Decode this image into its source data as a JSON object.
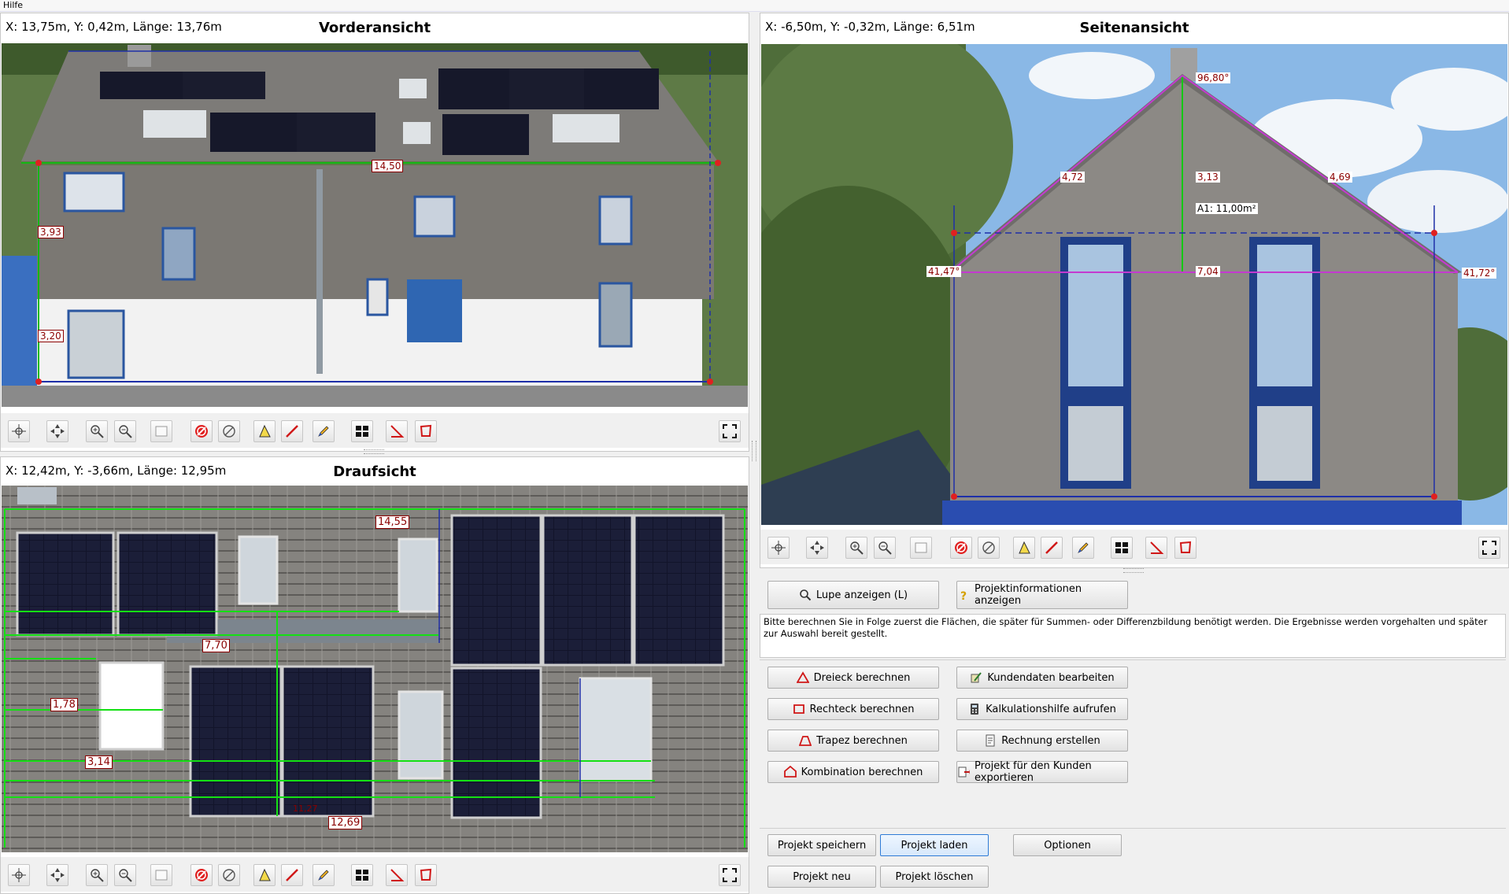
{
  "menu": {
    "help": "Hilfe"
  },
  "front": {
    "coords": "X: 13,75m, Y: 0,42m, Länge: 13,76m",
    "title": "Vorderansicht",
    "labels": [
      "14,50",
      "3,93",
      "3,20"
    ]
  },
  "side": {
    "coords": "X: -6,50m, Y: -0,32m, Länge: 6,51m",
    "title": "Seitenansicht",
    "labels": [
      "96,80°",
      "4,72",
      "4,69",
      "3,13",
      "A1: 11,00m²",
      "41,47°",
      "7,04",
      "41,72°"
    ]
  },
  "top": {
    "coords": "X: 12,42m, Y: -3,66m, Länge: 12,95m",
    "title": "Draufsicht",
    "labels": [
      "14,55",
      "7,70",
      "1,78",
      "3,14",
      "12,69",
      "11,27"
    ]
  },
  "toolbar_icons": [
    "center-icon",
    "move-icon",
    "zoom-in-icon",
    "zoom-out-icon",
    "frame-icon",
    "delete-red-icon",
    "cancel-icon",
    "triangle-measure-icon",
    "line-measure-icon",
    "pencil-icon",
    "module-grid-icon",
    "angle-icon",
    "polygon-icon",
    "fullscreen-icon"
  ],
  "actions": {
    "magnifier": "Lupe anzeigen (L)",
    "project_info": "Projektinformationen anzeigen",
    "info_text": "Bitte berechnen Sie in Folge zuerst die Flächen, die später für Summen- oder Differenzbildung benötigt werden. Die Ergebnisse werden vorgehalten und später zur Auswahl bereit gestellt.",
    "triangle": "Dreieck berechnen",
    "rectangle": "Rechteck berechnen",
    "trapezoid": "Trapez berechnen",
    "combination": "Kombination berechnen",
    "customer_data": "Kundendaten bearbeiten",
    "calc_help": "Kalkulationshilfe aufrufen",
    "invoice": "Rechnung erstellen",
    "export": "Projekt für den Kunden exportieren",
    "save": "Projekt speichern",
    "load": "Projekt laden",
    "options": "Optionen",
    "new": "Projekt neu",
    "delete": "Projekt löschen"
  }
}
